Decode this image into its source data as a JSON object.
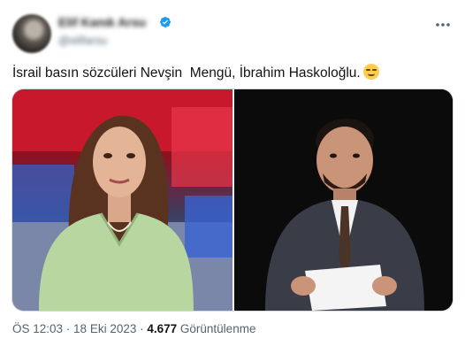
{
  "author": {
    "display_name": "Elif Kanık Arsu",
    "handle": "@elifarsu",
    "verified": true
  },
  "tweet": {
    "text": "İsrail basın sözcüleri Nevşin  Mengü, İbrahim Haskoloğlu.",
    "emoji": "relieved-face"
  },
  "meta": {
    "time": "ÖS 12:03",
    "sep1": " · ",
    "date": "18 Eki 2023",
    "sep2": " · ",
    "views": "4.677",
    "views_label": " Görüntülenme"
  },
  "colors": {
    "text": "#0f1419",
    "secondary": "#536471",
    "verified": "#1d9bf0",
    "border": "#cfd9de"
  }
}
